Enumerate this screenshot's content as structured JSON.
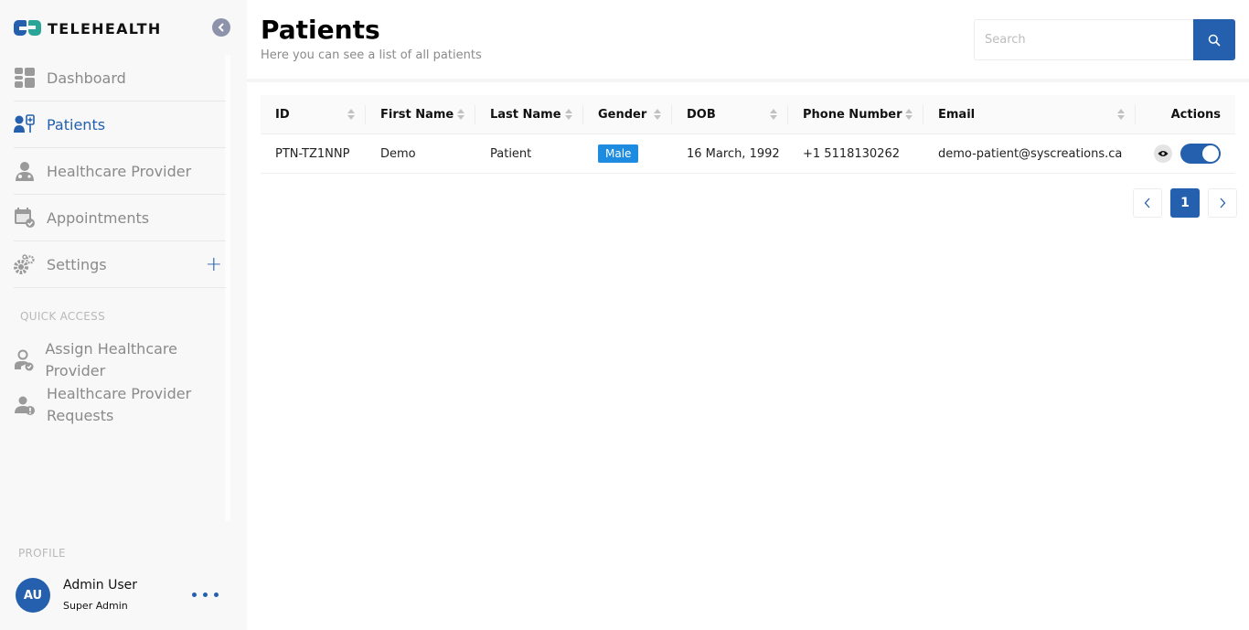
{
  "app": {
    "brand": "TELEHEALTH",
    "colors": {
      "primary": "#2460ad",
      "secondary": "#2aa598",
      "badge": "#1d8ce0",
      "muted": "#8a8a8a"
    }
  },
  "sidebar": {
    "collapse_icon": "chevron-left-icon",
    "nav": [
      {
        "label": "Dashboard",
        "icon": "dashboard-icon",
        "active": false
      },
      {
        "label": "Patients",
        "icon": "patients-icon",
        "active": true
      },
      {
        "label": "Healthcare Provider",
        "icon": "doctor-icon",
        "active": false
      },
      {
        "label": "Appointments",
        "icon": "calendar-check-icon",
        "active": false
      },
      {
        "label": "Settings",
        "icon": "gears-icon",
        "active": false,
        "expand": "+"
      }
    ],
    "quick_access": {
      "title": "QUICK ACCESS",
      "items": [
        {
          "label": "Assign Healthcare Provider",
          "icon": "assign-provider-icon"
        },
        {
          "label": "Healthcare Provider Requests",
          "icon": "provider-request-icon"
        }
      ]
    },
    "profile": {
      "title": "PROFILE",
      "initials": "AU",
      "name": "Admin User",
      "role": "Super Admin"
    }
  },
  "header": {
    "title": "Patients",
    "subtitle": "Here you can see a list of all patients",
    "search": {
      "placeholder": "Search",
      "value": ""
    }
  },
  "table": {
    "columns": [
      "ID",
      "First Name",
      "Last Name",
      "Gender",
      "DOB",
      "Phone Number",
      "Email",
      "Actions"
    ],
    "rows": [
      {
        "id": "PTN-TZ1NNP",
        "first_name": "Demo",
        "last_name": "Patient",
        "gender": "Male",
        "dob": "16 March, 1992",
        "phone": "+1 5118130262",
        "email": "demo-patient@syscreations.ca",
        "active": true
      }
    ]
  },
  "pagination": {
    "prev": "<",
    "current": "1",
    "next": ">"
  }
}
